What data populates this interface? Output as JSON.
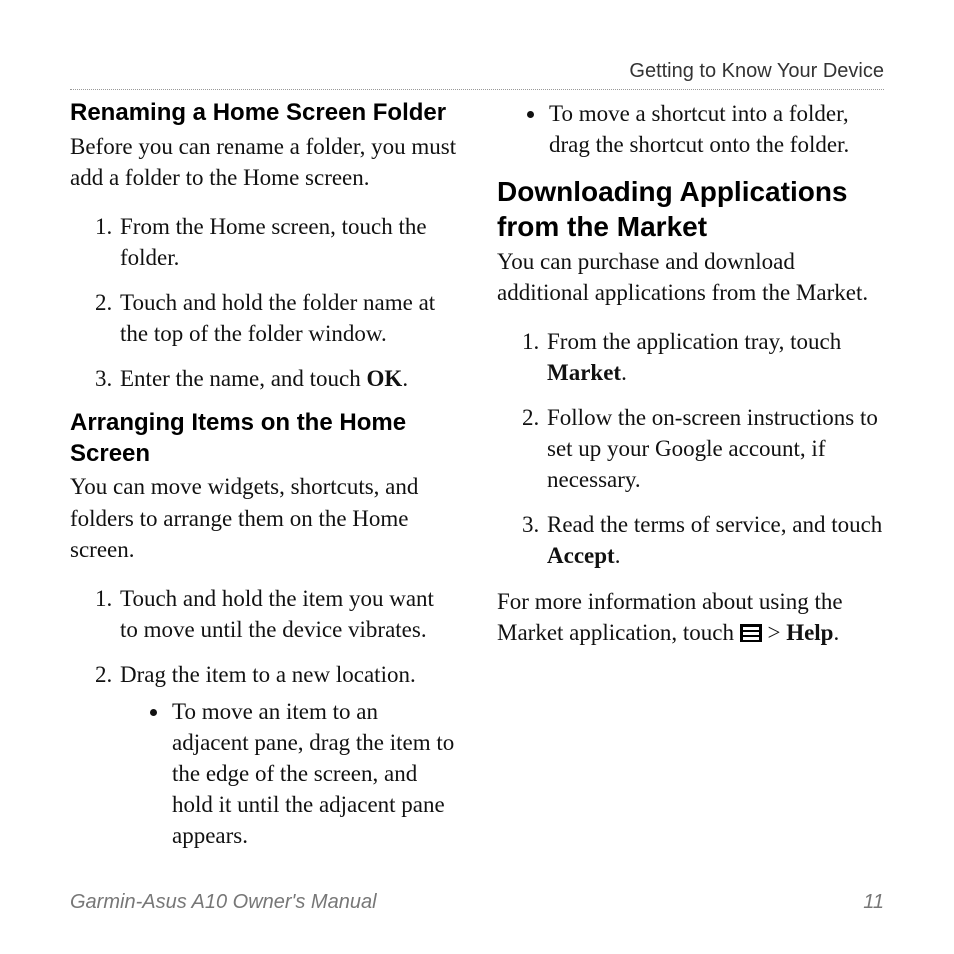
{
  "header": {
    "section_label": "Getting to Know Your Device"
  },
  "col1": {
    "h3a": "Renaming a Home Screen Folder",
    "p1": "Before you can rename a folder, you must add a folder to the Home screen.",
    "steps_a": [
      "From the Home screen, touch the folder.",
      "Touch and hold the folder name at the top of the folder window."
    ],
    "step_a3_pre": "Enter the name, and touch ",
    "step_a3_bold": "OK",
    "step_a3_post": ".",
    "h3b": "Arranging Items on the Home Screen",
    "p2": "You can move widgets, shortcuts, and folders to arrange them on the Home screen.",
    "steps_b": [
      "Touch and hold the item you want to move until the device vibrates.",
      "Drag the item to a new location."
    ],
    "bullet_b1": "To move an item to an adjacent pane, drag the item to the edge of the screen, and hold it until the adjacent pane appears."
  },
  "col2": {
    "bullet_top": "To move a shortcut into a folder, drag the shortcut onto the folder.",
    "h2": "Downloading Applications from the Market",
    "p1": "You can purchase and download additional applications from the Market.",
    "step1_pre": "From the application tray, touch ",
    "step1_bold": "Market",
    "step1_post": ".",
    "step2": "Follow the on-screen instructions to set up your Google account, if necessary.",
    "step3_pre": "Read the terms of service, and touch ",
    "step3_bold": "Accept",
    "step3_post": ".",
    "p2_pre": "For more information about using the Market application, touch ",
    "p2_mid": " > ",
    "p2_bold": "Help",
    "p2_post": "."
  },
  "footer": {
    "manual": "Garmin-Asus A10 Owner's Manual",
    "page": "11"
  }
}
